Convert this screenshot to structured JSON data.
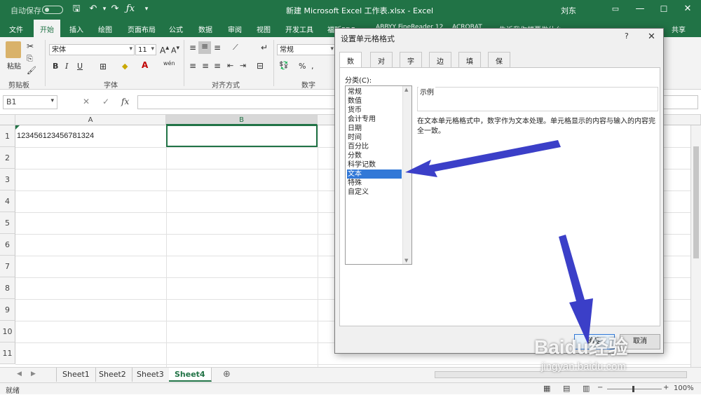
{
  "titlebar": {
    "autosave": "自动保存",
    "title": "新建 Microsoft Excel 工作表.xlsx - Excel",
    "user": "刘东"
  },
  "menu": {
    "items": [
      "文件",
      "开始",
      "插入",
      "绘图",
      "页面布局",
      "公式",
      "数据",
      "审阅",
      "视图",
      "开发工具",
      "福昕PDF",
      "ABBYY FineReader 12",
      "ACROBAT",
      "告诉我你想要做什么"
    ],
    "share": "共享"
  },
  "ribbon": {
    "paste": "粘贴",
    "font_name": "宋体",
    "font_size": "11",
    "number_format": "常规",
    "groups": {
      "clipboard": "剪贴板",
      "font": "字体",
      "align": "对齐方式",
      "number": "数字"
    },
    "bold": "B",
    "italic": "I",
    "underline": "U",
    "percent": "%",
    "wen": "wén"
  },
  "formula": {
    "namebox": "B1",
    "fx": "fx",
    "cancel": "✕",
    "enter": "✓"
  },
  "sheet": {
    "cols": [
      "A",
      "B"
    ],
    "rows": [
      "1",
      "2",
      "3",
      "4",
      "5",
      "6",
      "7",
      "8",
      "9",
      "10",
      "11"
    ],
    "a1": "123456123456781324"
  },
  "tabs": {
    "sheets": [
      "Sheet1",
      "Sheet2",
      "Sheet3",
      "Sheet4"
    ],
    "active": "Sheet4",
    "add": "⊕"
  },
  "status": {
    "ready": "就绪",
    "zoom": "100%"
  },
  "dialog": {
    "title": "设置单元格格式",
    "help": "?",
    "close": "✕",
    "tabs": [
      "数字",
      "对齐",
      "字体",
      "边框",
      "填充",
      "保护"
    ],
    "category_label": "分类(C):",
    "categories": [
      "常规",
      "数值",
      "货币",
      "会计专用",
      "日期",
      "时间",
      "百分比",
      "分数",
      "科学记数",
      "文本",
      "特殊",
      "自定义"
    ],
    "selected": "文本",
    "sample_label": "示例",
    "description": "在文本单元格格式中，数字作为文本处理。单元格显示的内容与输入的内容完全一致。",
    "ok": "确定",
    "cancel": "取消"
  },
  "watermark": {
    "brand": "Baidu经验",
    "url": "jingyan.baidu.com"
  },
  "colors": {
    "excel_green": "#217346",
    "selection_blue": "#3278d7",
    "arrow": "#3b3fc8"
  }
}
